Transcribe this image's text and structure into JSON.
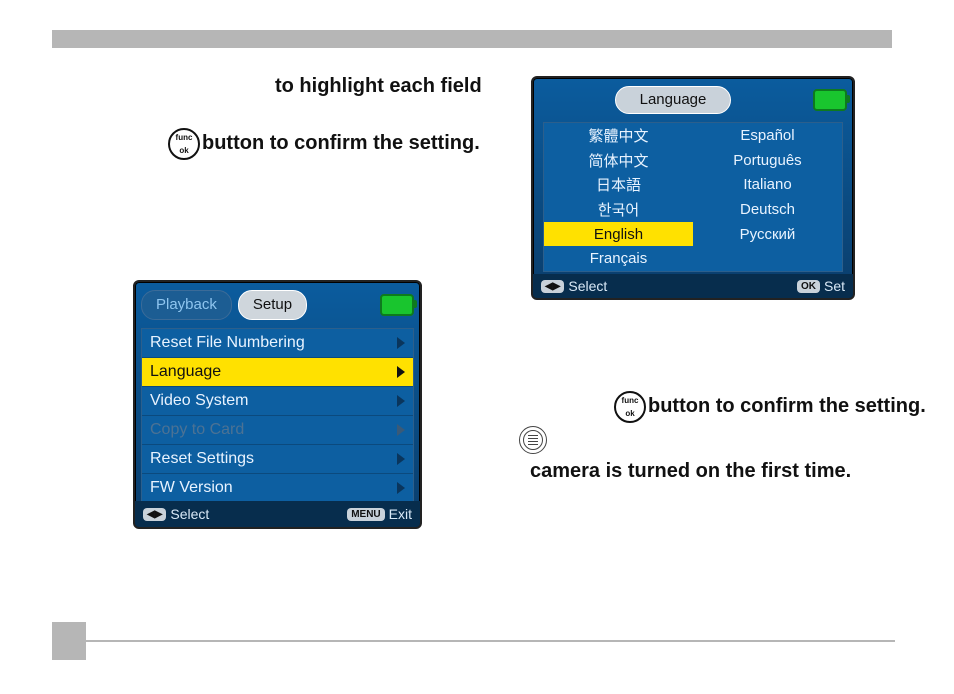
{
  "instructions": {
    "highlight": "to highlight each field",
    "confirm1": "button to confirm the setting.",
    "confirm2": "button to confirm the setting.",
    "firstTime": "camera is turned on the first time."
  },
  "setupScreen": {
    "tabs": {
      "playback": "Playback",
      "setup": "Setup"
    },
    "items": [
      "Reset File Numbering",
      "Language",
      "Video System",
      "Copy to Card",
      "Reset Settings",
      "FW Version"
    ],
    "highlightedIndex": 1,
    "disabledIndex": 3,
    "footer": {
      "select": "Select",
      "exit": "Exit",
      "selectKey": "◀▶",
      "exitKey": "MENU"
    }
  },
  "languageScreen": {
    "title": "Language",
    "left": [
      "繁體中文",
      "简体中文",
      "日本語",
      "한국어",
      "English",
      "Français"
    ],
    "right": [
      "Español",
      "Português",
      "Italiano",
      "Deutsch",
      "Русский"
    ],
    "highlighted": "English",
    "footer": {
      "select": "Select",
      "set": "Set",
      "selectKey": "◀▶",
      "setKey": "OK"
    }
  }
}
